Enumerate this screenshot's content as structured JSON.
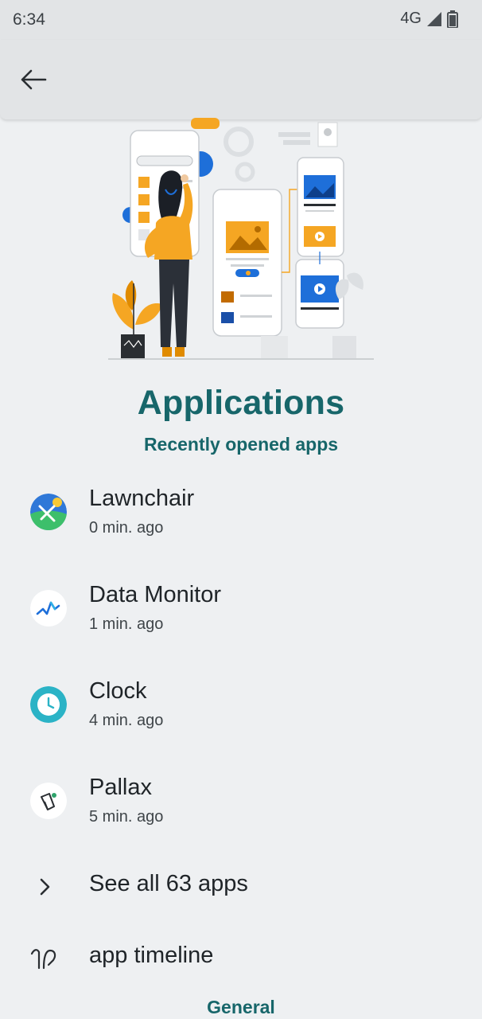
{
  "status_bar": {
    "time": "6:34",
    "network": "4G"
  },
  "header": {
    "back_icon": "arrow-left-icon"
  },
  "illustration": {
    "description_icon": "app-screens-illustration"
  },
  "title": "Applications",
  "subtitle": "Recently opened apps",
  "recent_apps": [
    {
      "name": "Lawnchair",
      "time": "0 min. ago",
      "icon": "lawnchair-icon"
    },
    {
      "name": "Data Monitor",
      "time": "1 min. ago",
      "icon": "data-monitor-icon"
    },
    {
      "name": "Clock",
      "time": "4 min. ago",
      "icon": "clock-icon"
    },
    {
      "name": "Pallax",
      "time": "5 min. ago",
      "icon": "pallax-icon"
    }
  ],
  "see_all": {
    "label": "See all 63 apps",
    "icon": "chevron-right-icon"
  },
  "timeline": {
    "label": "app timeline",
    "icon": "timeline-icon"
  },
  "section": {
    "label": "General"
  },
  "colors": {
    "accent": "#17666a",
    "background": "#eef0f2",
    "appbar": "#e2e4e6"
  }
}
